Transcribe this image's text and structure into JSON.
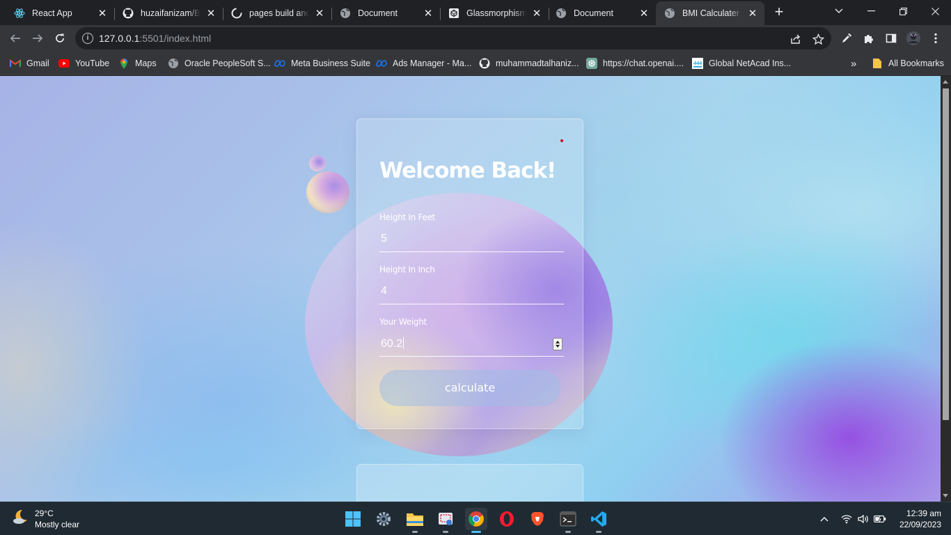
{
  "browser": {
    "tabs": [
      {
        "title": "React App",
        "icon": "react-icon"
      },
      {
        "title": "huzaifanizam/Birthday",
        "icon": "github-icon"
      },
      {
        "title": "pages build and deployment",
        "icon": "github-actions-icon"
      },
      {
        "title": "Document",
        "icon": "globe-icon"
      },
      {
        "title": "Glassmorphism UI",
        "icon": "codepen-icon"
      },
      {
        "title": "Document",
        "icon": "globe-icon"
      },
      {
        "title": "BMI Calculater App",
        "icon": "globe-icon",
        "active": true
      }
    ],
    "url": {
      "host": "127.0.0.1",
      "rest": ":5501/index.html"
    },
    "bookmarks": [
      {
        "label": "Gmail",
        "icon": "gmail-icon"
      },
      {
        "label": "YouTube",
        "icon": "youtube-icon"
      },
      {
        "label": "Maps",
        "icon": "maps-icon"
      },
      {
        "label": "Oracle PeopleSoft S...",
        "icon": "globe-icon"
      },
      {
        "label": "Meta Business Suite",
        "icon": "meta-icon"
      },
      {
        "label": "Ads Manager - Ma...",
        "icon": "meta-icon"
      },
      {
        "label": "muhammadtalhaniz...",
        "icon": "github-icon"
      },
      {
        "label": "https://chat.openai....",
        "icon": "openai-icon"
      },
      {
        "label": "Global NetAcad Ins...",
        "icon": "cisco-icon"
      }
    ],
    "bookmarks_overflow": "»",
    "all_bookmarks": "All Bookmarks"
  },
  "page": {
    "title": "Welcome Back!",
    "fields": [
      {
        "label": "Height In Feet",
        "value": "5"
      },
      {
        "label": "Height In Inch",
        "value": "4"
      },
      {
        "label": "Your Weight",
        "value": "60.2"
      }
    ],
    "button": "calculate"
  },
  "taskbar": {
    "weather": {
      "temp": "29°C",
      "condition": "Mostly clear"
    },
    "time": "12:39 am",
    "date": "22/09/2023",
    "apps": [
      "start-icon",
      "settings-icon",
      "file-explorer-icon",
      "snipping-tool-icon",
      "chrome-icon",
      "opera-icon",
      "brave-icon",
      "terminal-icon",
      "vscode-icon"
    ]
  },
  "colors": {
    "accent": "#4cc2ff",
    "page_background": "#a8c8ee",
    "blob_purple": "#8e6ee1"
  }
}
